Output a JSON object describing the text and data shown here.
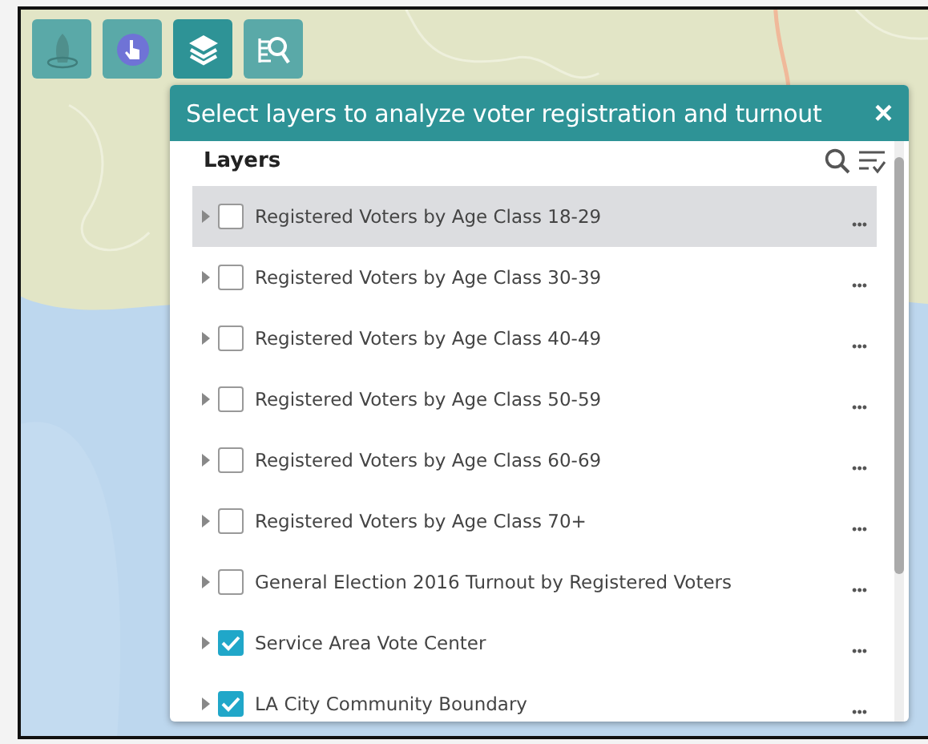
{
  "toolbar": [
    {
      "kind": "basemap",
      "selected": false
    },
    {
      "kind": "select",
      "selected": false
    },
    {
      "kind": "layers",
      "selected": true
    },
    {
      "kind": "query",
      "selected": false
    }
  ],
  "panel": {
    "title": "Select layers to analyze voter registration and turnout",
    "close": "×",
    "heading": "Layers",
    "layers": [
      {
        "name": "Registered Voters by Age Class 18-29",
        "checked": false,
        "selected": true,
        "menu": "•••"
      },
      {
        "name": "Registered Voters by Age Class 30-39",
        "checked": false,
        "selected": false,
        "menu": "•••"
      },
      {
        "name": "Registered Voters by Age Class 40-49",
        "checked": false,
        "selected": false,
        "menu": "•••"
      },
      {
        "name": "Registered Voters by Age Class 50-59",
        "checked": false,
        "selected": false,
        "menu": "•••"
      },
      {
        "name": "Registered Voters by Age Class 60-69",
        "checked": false,
        "selected": false,
        "menu": "•••"
      },
      {
        "name": "Registered Voters by Age Class 70+",
        "checked": false,
        "selected": false,
        "menu": "•••"
      },
      {
        "name": "General Election 2016 Turnout by Registered Voters",
        "checked": false,
        "selected": false,
        "menu": "•••"
      },
      {
        "name": "Service Area Vote Center",
        "checked": true,
        "selected": false,
        "menu": "•••"
      },
      {
        "name": "LA City Community Boundary",
        "checked": true,
        "selected": false,
        "menu": "•••"
      }
    ]
  }
}
